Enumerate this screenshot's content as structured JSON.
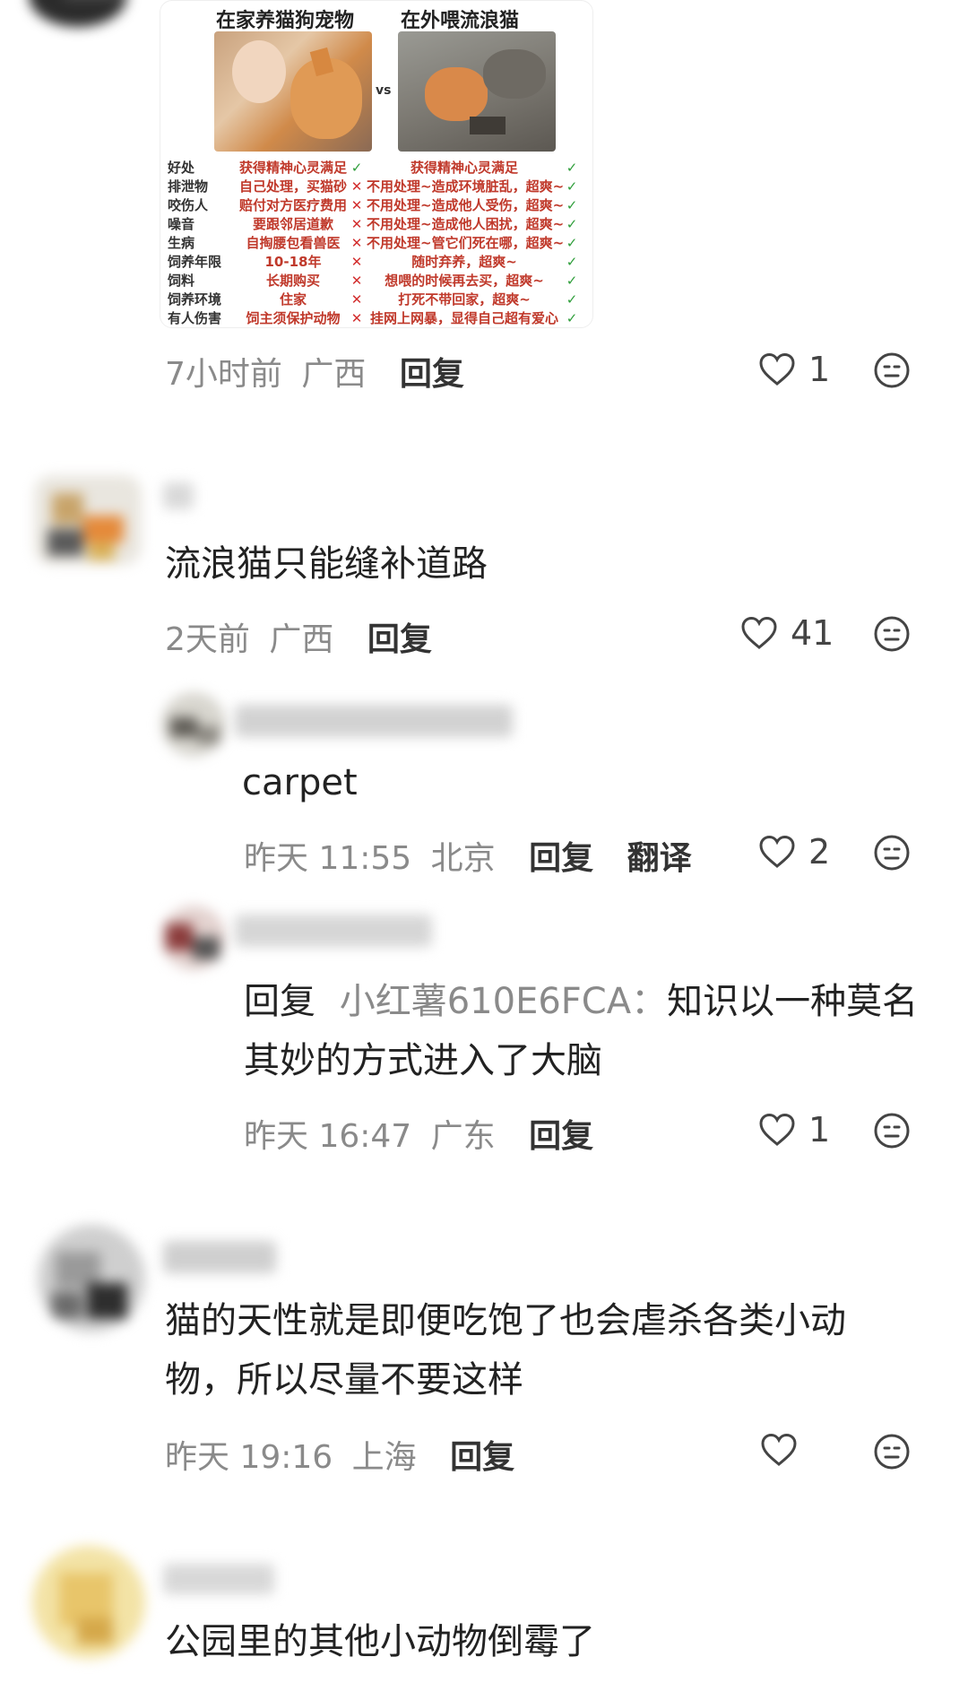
{
  "colors": {
    "meta_gray": "#8a8a8a",
    "text_dark": "#222222",
    "check_green": "#2e9e3a",
    "cross_red": "#d32f2f",
    "infographic_red": "#c0392b"
  },
  "comments": [
    {
      "image": {
        "left_title": "在家养猫狗宠物",
        "right_title": "在外喂流浪猫",
        "vs": "vs",
        "rows": [
          {
            "category": "好处",
            "left": "获得精神心灵满足",
            "left_mark": "✓",
            "right": "获得精神心灵满足",
            "right_mark": "✓"
          },
          {
            "category": "排泄物",
            "left": "自己处理，买猫砂",
            "left_mark": "✕",
            "right": "不用处理~造成环境脏乱，超爽~",
            "right_mark": "✓"
          },
          {
            "category": "咬伤人",
            "left": "赔付对方医疗费用",
            "left_mark": "✕",
            "right": "不用处理~造成他人受伤，超爽~",
            "right_mark": "✓"
          },
          {
            "category": "噪音",
            "left": "要跟邻居道歉",
            "left_mark": "✕",
            "right": "不用处理~造成他人困扰，超爽~",
            "right_mark": "✓"
          },
          {
            "category": "生病",
            "left": "自掏腰包看兽医",
            "left_mark": "✕",
            "right": "不用处理~管它们死在哪，超爽~",
            "right_mark": "✓"
          },
          {
            "category": "饲养年限",
            "left": "10-18年",
            "left_mark": "✕",
            "right": "随时弃养，超爽~",
            "right_mark": "✓"
          },
          {
            "category": "饲料",
            "left": "长期购买",
            "left_mark": "✕",
            "right": "想喂的时候再去买，超爽~",
            "right_mark": "✓"
          },
          {
            "category": "饲养环境",
            "left": "住家",
            "left_mark": "✕",
            "right": "打死不带回家，超爽~",
            "right_mark": "✓"
          },
          {
            "category": "有人伤害",
            "left": "饲主须保护动物",
            "left_mark": "✕",
            "right": "挂网上网暴，显得自己超有爱心",
            "right_mark": "✓"
          }
        ]
      },
      "time": "7小时前",
      "location": "广西",
      "reply_label": "回复",
      "likes": "1"
    },
    {
      "text": "流浪猫只能缝补道路",
      "time": "2天前",
      "location": "广西",
      "reply_label": "回复",
      "likes": "41"
    },
    {
      "text": "carpet",
      "time": "昨天 11:55",
      "location": "北京",
      "reply_label": "回复",
      "translate_label": "翻译",
      "likes": "2"
    },
    {
      "reply_prefix": "回复",
      "reply_to": "小红薯610E6FCA",
      "separator": "：",
      "text_line1": "知识以一种莫名",
      "text_line2": "其妙的方式进入了大脑",
      "time": "昨天 16:47",
      "location": "广东",
      "reply_label": "回复",
      "likes": "1"
    },
    {
      "text_line1": "猫的天性就是即便吃饱了也会虐杀各类小动",
      "text_line2": "物，所以尽量不要这样",
      "time": "昨天 19:16",
      "location": "上海",
      "reply_label": "回复",
      "likes": ""
    },
    {
      "text": "公园里的其他小动物倒霉了"
    }
  ],
  "icons": {
    "like": "heart-outline-icon",
    "dislike": "neutral-face-icon"
  }
}
